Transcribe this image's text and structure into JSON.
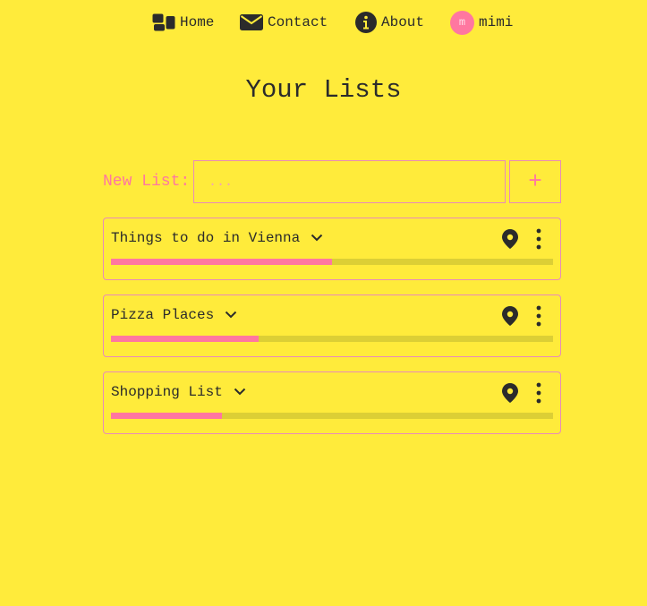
{
  "nav": {
    "home_label": "Home",
    "contact_label": "Contact",
    "about_label": "About",
    "user_initial": "m",
    "user_name": "mimi"
  },
  "page": {
    "title": "Your Lists"
  },
  "new_list": {
    "label": "New List:",
    "placeholder": "...",
    "add_symbol": "+"
  },
  "lists": [
    {
      "title": "Things to do in Vienna",
      "progress_percent": 50
    },
    {
      "title": "Pizza Places",
      "progress_percent": 33.4
    },
    {
      "title": "Shopping List",
      "progress_percent": 25
    }
  ],
  "icons": {
    "home": "dashboard-icon",
    "contact": "envelope-icon",
    "about": "info-icon",
    "expand": "chevron-down-icon",
    "location": "map-pin-icon",
    "menu": "more-vertical-icon"
  },
  "colors": {
    "background": "#ffeb3b",
    "accent": "#ff77a0",
    "border": "#e98bb8",
    "text": "#2b2b2b",
    "track": "#dccf35"
  }
}
